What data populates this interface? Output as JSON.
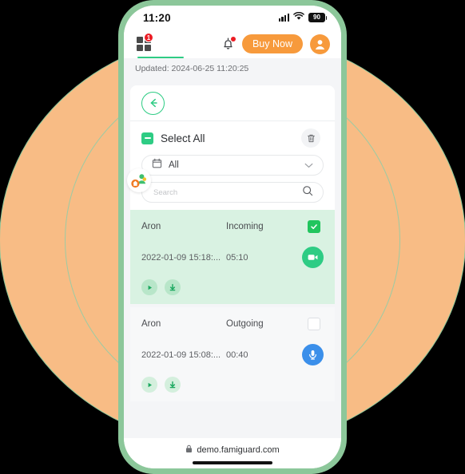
{
  "status_bar": {
    "time": "11:20",
    "signal_icon": "signal-bars-icon",
    "wifi_icon": "wifi-icon",
    "battery_level": "90"
  },
  "app_header": {
    "apps_icon": "apps-grid-icon",
    "apps_badge_count": "1",
    "bell_icon": "notification-bell-icon",
    "buy_now_label": "Buy Now",
    "avatar_icon": "user-avatar-icon",
    "accent_orange": "#F79A3C",
    "accent_green": "#2ECC84",
    "badge_red": "#EC1C24"
  },
  "updated": {
    "text": "Updated: 2024-06-25 11:20:25"
  },
  "controls": {
    "back_icon": "back-arrow-icon",
    "select_all_label": "Select All",
    "select_all_state": "indeterminate",
    "delete_icon": "trash-icon",
    "filter": {
      "icon": "calendar-icon",
      "value": "All",
      "chevron_icon": "chevron-down-icon"
    },
    "search": {
      "value": "",
      "placeholder": "Search",
      "icon": "search-icon"
    }
  },
  "records": [
    {
      "name": "Aron",
      "direction": "Incoming",
      "datetime": "2022-01-09 15:18:...",
      "duration": "05:10",
      "type": "video",
      "type_icon": "video-camera-icon",
      "type_color": "#2ECC84",
      "selected": true,
      "play_icon": "play-icon",
      "download_icon": "download-icon"
    },
    {
      "name": "Aron",
      "direction": "Outgoing",
      "datetime": "2022-01-09 15:08:...",
      "duration": "00:40",
      "type": "audio",
      "type_icon": "microphone-icon",
      "type_color": "#3B8FEA",
      "selected": false,
      "play_icon": "play-icon",
      "download_icon": "download-icon"
    }
  ],
  "floating_widget": {
    "icon": "family-guard-widget-icon"
  },
  "browser_bar": {
    "lock_icon": "lock-icon",
    "url": "demo.famiguard.com",
    "home_indicator": "home-indicator"
  },
  "decoration": {
    "background_color": "#000000",
    "circle_fill": "#F8BC85",
    "circle_stroke": "#8CC79A",
    "phone_frame_color": "#8CC79A"
  }
}
